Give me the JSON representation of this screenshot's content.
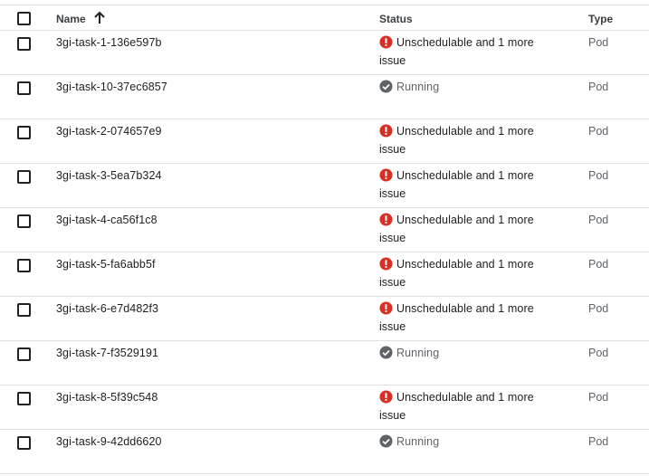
{
  "header": {
    "name_label": "Name",
    "status_label": "Status",
    "type_label": "Type",
    "sort_direction": "ascending"
  },
  "colors": {
    "error": "#d93025",
    "running": "#5f6368",
    "border": "#e0e0e0"
  },
  "rows": [
    {
      "name": "3gi-task-1-136e597b",
      "status": "Unschedulable and 1 more",
      "status_cont": "issue",
      "status_icon": "error-icon",
      "type": "Pod"
    },
    {
      "name": "3gi-task-10-37ec6857",
      "status": "Running",
      "status_cont": "",
      "status_icon": "check-circle-icon",
      "type": "Pod"
    },
    {
      "name": "3gi-task-2-074657e9",
      "status": "Unschedulable and 1 more",
      "status_cont": "issue",
      "status_icon": "error-icon",
      "type": "Pod"
    },
    {
      "name": "3gi-task-3-5ea7b324",
      "status": "Unschedulable and 1 more",
      "status_cont": "issue",
      "status_icon": "error-icon",
      "type": "Pod"
    },
    {
      "name": "3gi-task-4-ca56f1c8",
      "status": "Unschedulable and 1 more",
      "status_cont": "issue",
      "status_icon": "error-icon",
      "type": "Pod"
    },
    {
      "name": "3gi-task-5-fa6abb5f",
      "status": "Unschedulable and 1 more",
      "status_cont": "issue",
      "status_icon": "error-icon",
      "type": "Pod"
    },
    {
      "name": "3gi-task-6-e7d482f3",
      "status": "Unschedulable and 1 more",
      "status_cont": "issue",
      "status_icon": "error-icon",
      "type": "Pod"
    },
    {
      "name": "3gi-task-7-f3529191",
      "status": "Running",
      "status_cont": "",
      "status_icon": "check-circle-icon",
      "type": "Pod"
    },
    {
      "name": "3gi-task-8-5f39c548",
      "status": "Unschedulable and 1 more",
      "status_cont": "issue",
      "status_icon": "error-icon",
      "type": "Pod"
    },
    {
      "name": "3gi-task-9-42dd6620",
      "status": "Running",
      "status_cont": "",
      "status_icon": "check-circle-icon",
      "type": "Pod"
    }
  ]
}
